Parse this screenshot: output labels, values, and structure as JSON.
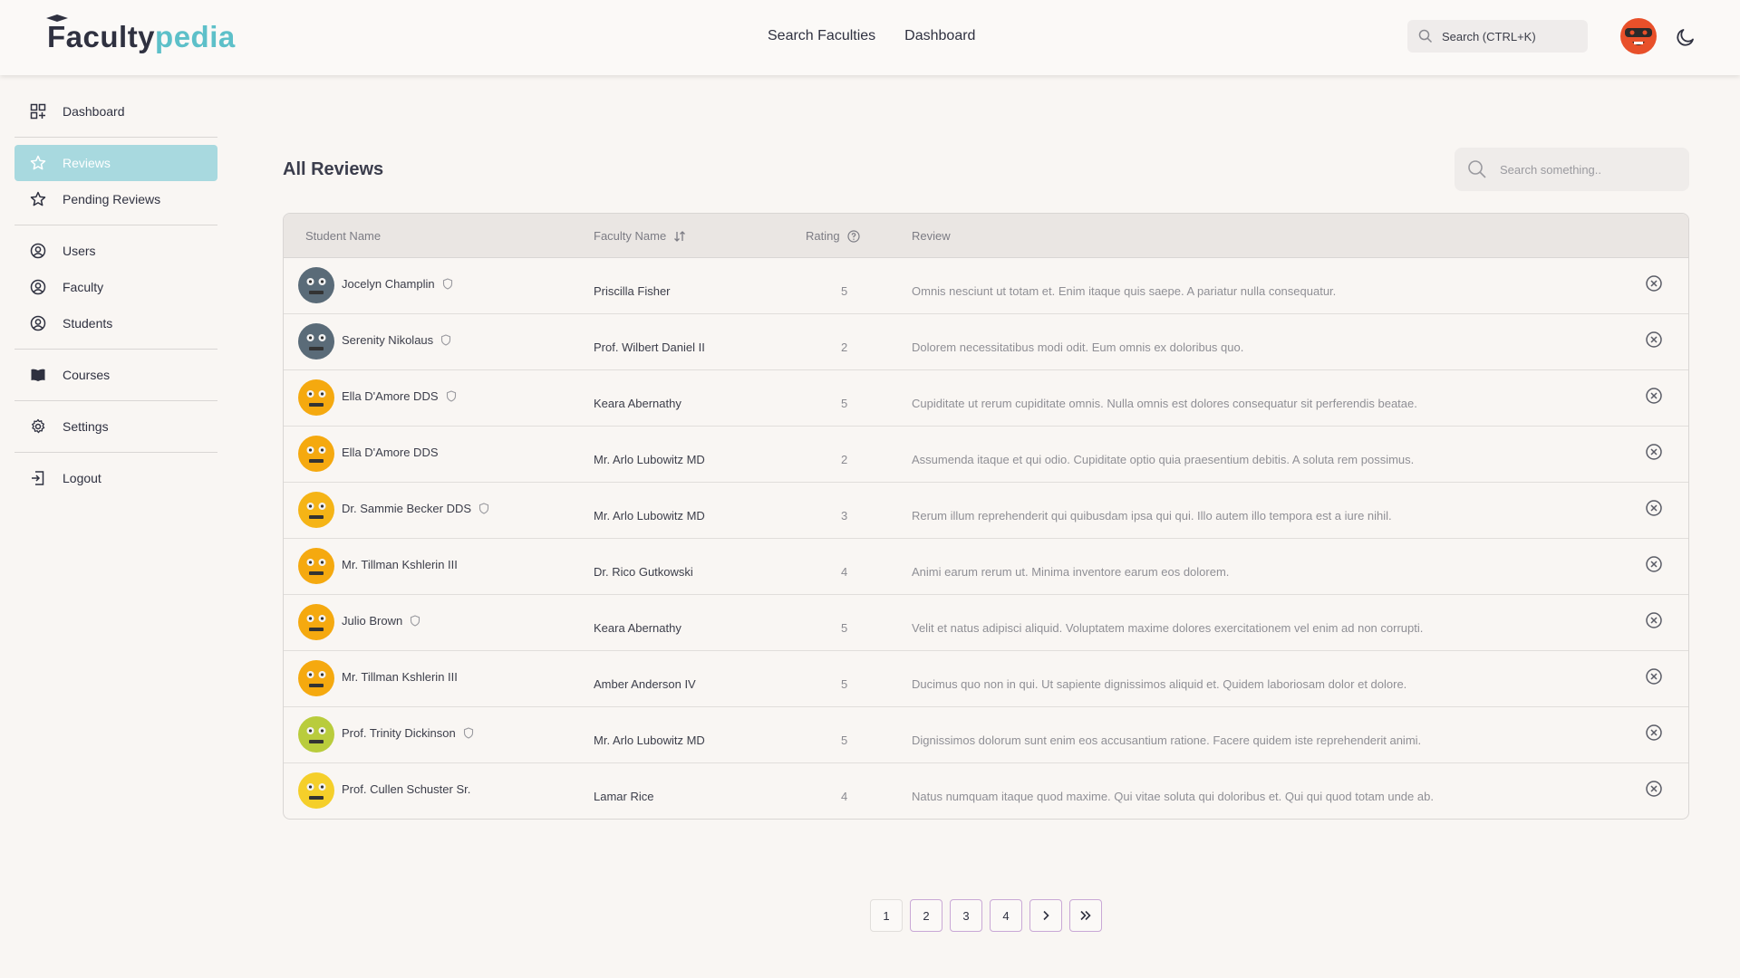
{
  "header": {
    "logo_part1": "Faculty",
    "logo_part2": "pedia",
    "nav": [
      "Search Faculties",
      "Dashboard"
    ],
    "search_placeholder": "Search (CTRL+K)"
  },
  "sidebar": {
    "items": [
      {
        "label": "Dashboard",
        "icon": "dashboard-icon"
      },
      {
        "label": "Reviews",
        "icon": "star-icon",
        "active": true
      },
      {
        "label": "Pending Reviews",
        "icon": "star-icon"
      },
      {
        "label": "Users",
        "icon": "user-circle-icon"
      },
      {
        "label": "Faculty",
        "icon": "user-circle-icon"
      },
      {
        "label": "Students",
        "icon": "user-circle-icon"
      },
      {
        "label": "Courses",
        "icon": "book-icon"
      },
      {
        "label": "Settings",
        "icon": "gear-icon"
      },
      {
        "label": "Logout",
        "icon": "logout-icon"
      }
    ]
  },
  "main": {
    "title": "All Reviews",
    "search_placeholder": "Search something..",
    "columns": [
      "Student Name",
      "Faculty Name",
      "Rating",
      "Review"
    ],
    "rows": [
      {
        "student": "Jocelyn Champlin",
        "verified": true,
        "faculty": "Priscilla Fisher",
        "rating": "5",
        "review": "Omnis nesciunt ut totam et. Enim itaque quis saepe. A pariatur nulla consequatur.",
        "avatar_color": "#5a6b78"
      },
      {
        "student": "Serenity Nikolaus",
        "verified": true,
        "faculty": "Prof. Wilbert Daniel II",
        "rating": "2",
        "review": "Dolorem necessitatibus modi odit. Eum omnis ex doloribus quo.",
        "avatar_color": "#5a6b78"
      },
      {
        "student": "Ella D'Amore DDS",
        "verified": true,
        "faculty": "Keara Abernathy",
        "rating": "5",
        "review": "Cupiditate ut rerum cupiditate omnis. Nulla omnis est dolores consequatur sit perferendis beatae.",
        "avatar_color": "#f5a90f"
      },
      {
        "student": "Ella D'Amore DDS",
        "verified": false,
        "faculty": "Mr. Arlo Lubowitz MD",
        "rating": "2",
        "review": "Assumenda itaque et qui odio. Cupiditate optio quia praesentium debitis. A soluta rem possimus.",
        "avatar_color": "#f5a90f"
      },
      {
        "student": "Dr. Sammie Becker DDS",
        "verified": true,
        "faculty": "Mr. Arlo Lubowitz MD",
        "rating": "3",
        "review": "Rerum illum reprehenderit qui quibusdam ipsa qui qui. Illo autem illo tempora est a iure nihil.",
        "avatar_color": "#f5b416"
      },
      {
        "student": "Mr. Tillman Kshlerin III",
        "verified": false,
        "faculty": "Dr. Rico Gutkowski",
        "rating": "4",
        "review": "Animi earum rerum ut. Minima inventore earum eos dolorem.",
        "avatar_color": "#f5a90f"
      },
      {
        "student": "Julio Brown",
        "verified": true,
        "faculty": "Keara Abernathy",
        "rating": "5",
        "review": "Velit et natus adipisci aliquid. Voluptatem maxime dolores exercitationem vel enim ad non corrupti.",
        "avatar_color": "#f5a90f"
      },
      {
        "student": "Mr. Tillman Kshlerin III",
        "verified": false,
        "faculty": "Amber Anderson IV",
        "rating": "5",
        "review": "Ducimus quo non in qui. Ut sapiente dignissimos aliquid et. Quidem laboriosam dolor et dolore.",
        "avatar_color": "#f5a90f"
      },
      {
        "student": "Prof. Trinity Dickinson",
        "verified": true,
        "faculty": "Mr. Arlo Lubowitz MD",
        "rating": "5",
        "review": "Dignissimos dolorum sunt enim eos accusantium ratione. Facere quidem iste reprehenderit animi.",
        "avatar_color": "#b9cc3c"
      },
      {
        "student": "Prof. Cullen Schuster Sr.",
        "verified": false,
        "faculty": "Lamar Rice",
        "rating": "4",
        "review": "Natus numquam itaque quod maxime. Qui vitae soluta qui doloribus et. Qui qui quod totam unde ab.",
        "avatar_color": "#f5cf2a"
      }
    ]
  },
  "pagination": {
    "pages": [
      "1",
      "2",
      "3",
      "4"
    ],
    "current": "1",
    "next": "›",
    "last": "»"
  },
  "colors": {
    "accent": "#5dc0c9",
    "active_bg": "#a8d9df",
    "pager_border": "#c9a8d6"
  }
}
